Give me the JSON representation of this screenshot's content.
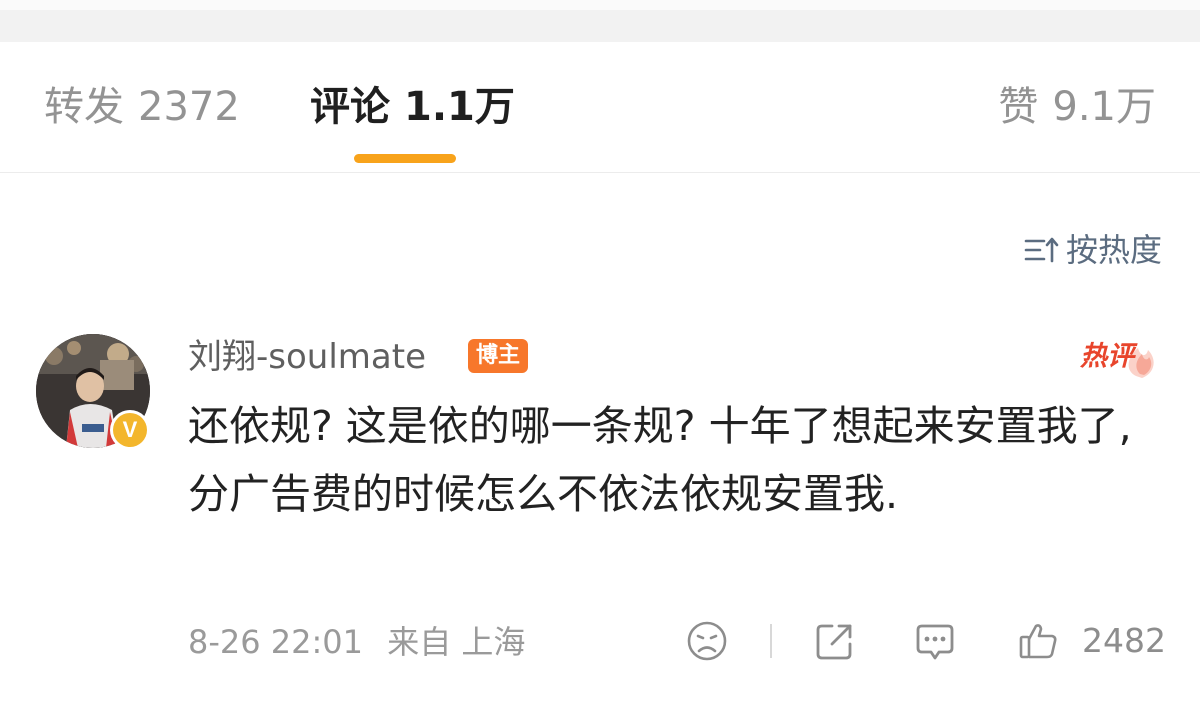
{
  "tabs": {
    "forward": {
      "label": "转发",
      "count": "2372"
    },
    "comments": {
      "label": "评论",
      "count": "1.1万"
    },
    "likes": {
      "label": "赞",
      "count": "9.1万"
    }
  },
  "sort": {
    "label": "按热度"
  },
  "comment": {
    "username": "刘翔-soulmate",
    "badge": "博主",
    "hot_tag": "热评",
    "verified_mark": "V",
    "text": "还依规? 这是依的哪一条规? 十年了想起来安置我了, 分广告费的时候怎么不依法依规安置我.",
    "timestamp": "8-26 22:01",
    "source": "来自 上海",
    "like_count": "2482"
  },
  "colors": {
    "accent": "#f8a31b",
    "badge": "#f7772b",
    "verified": "#f3b62c",
    "hot": "#e8452c",
    "sort": "#5b6c80"
  },
  "icons": {
    "sort": "sort-lines-arrow-icon",
    "dislike": "sad-face-icon",
    "share": "share-icon",
    "reply": "comment-bubble-icon",
    "like": "thumbs-up-icon"
  }
}
